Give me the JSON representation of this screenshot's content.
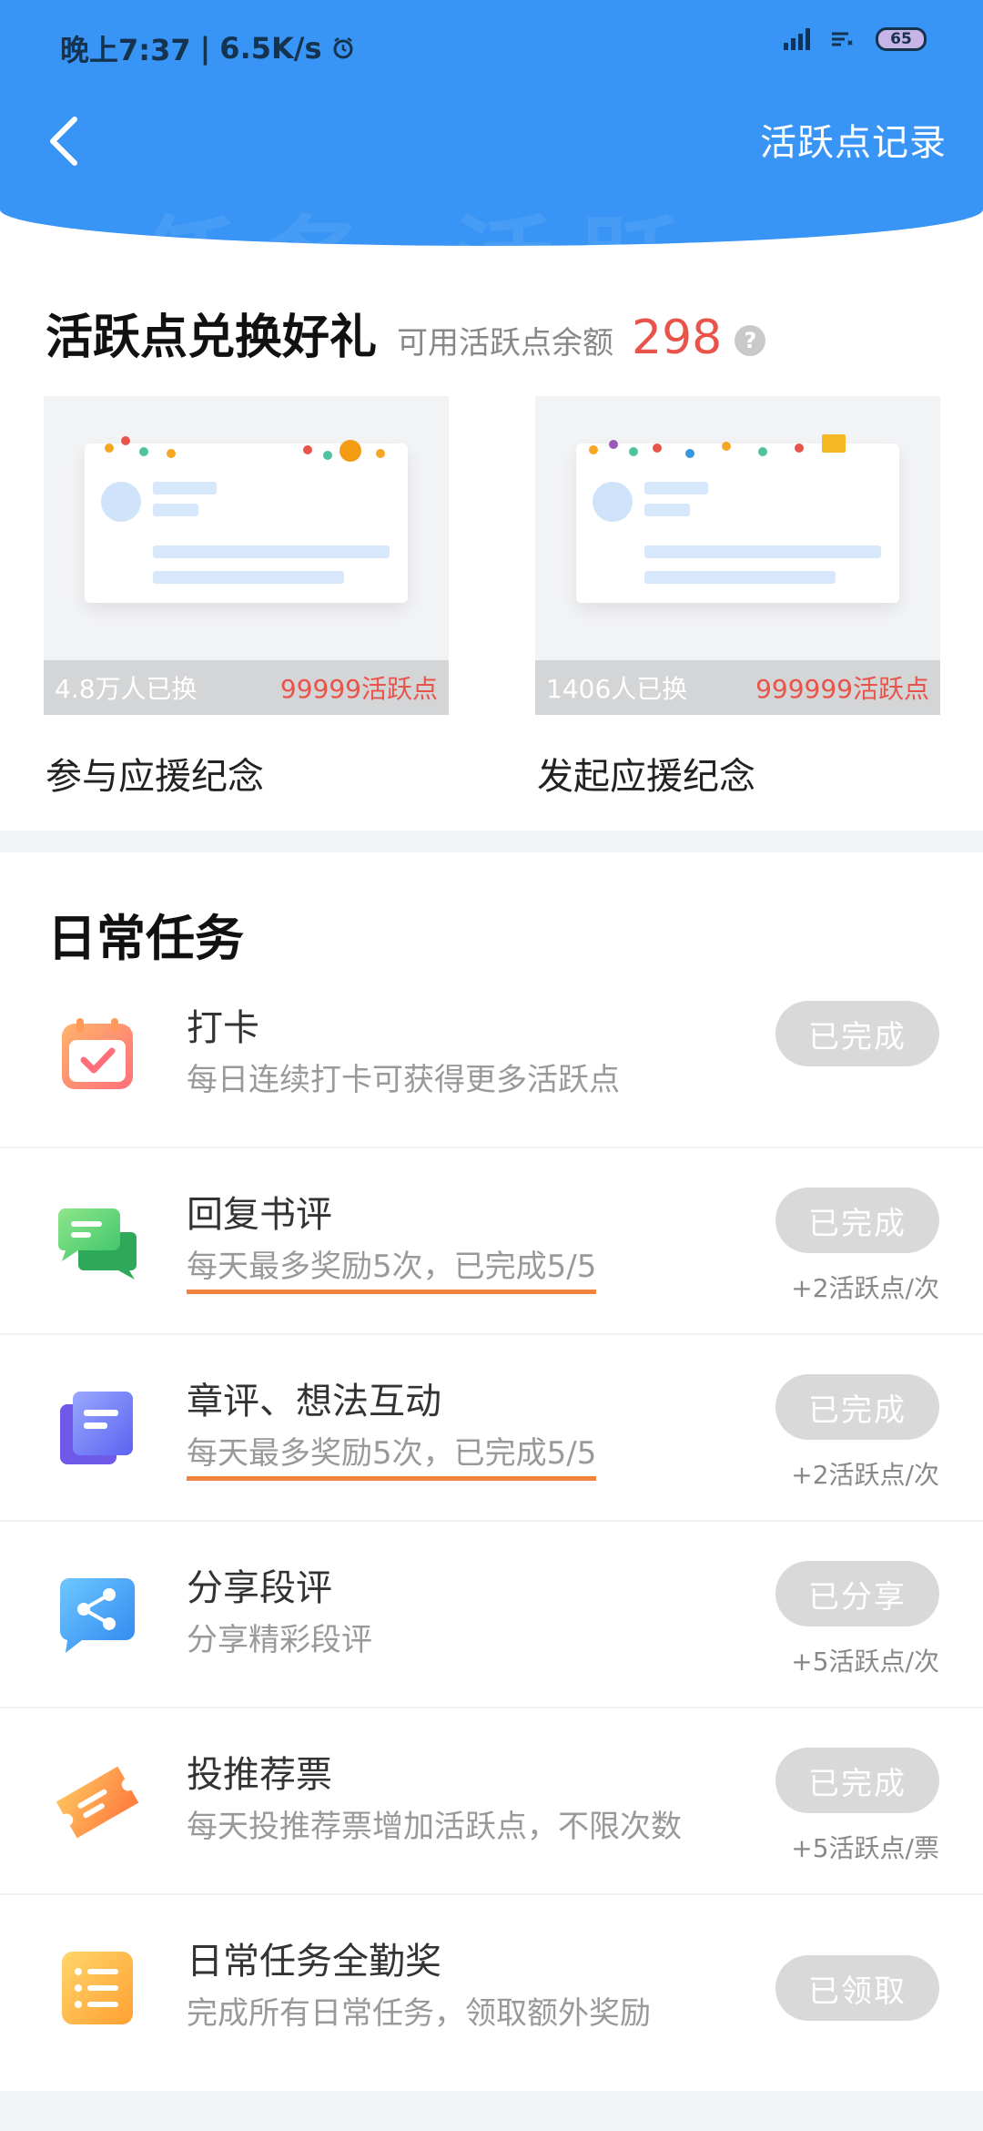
{
  "status_bar": {
    "time": "晚上7:37",
    "speed": "6.5K/s",
    "battery": "65"
  },
  "header": {
    "back_icon": "chevron-left-icon",
    "record_link": "活跃点记录"
  },
  "exchange": {
    "title": "活跃点兑换好礼",
    "balance_label": "可用活跃点余额",
    "balance": "298",
    "help_icon": "question-icon",
    "cards": [
      {
        "count": "4.8万人已换",
        "cost": "99999活跃点",
        "label": "参与应援纪念"
      },
      {
        "count": "1406人已换",
        "cost": "999999活跃点",
        "label": "发起应援纪念"
      }
    ]
  },
  "tasks": {
    "title": "日常任务",
    "items": [
      {
        "icon": "calendar-check-icon",
        "name": "打卡",
        "desc": "每日连续打卡可获得更多活跃点",
        "button": "已完成",
        "reward": ""
      },
      {
        "icon": "chat-bubbles-icon",
        "name": "回复书评",
        "desc": "每天最多奖励5次，已完成5/5",
        "button": "已完成",
        "reward": "+2活跃点/次"
      },
      {
        "icon": "document-icon",
        "name": "章评、想法互动",
        "desc": "每天最多奖励5次，已完成5/5",
        "button": "已完成",
        "reward": "+2活跃点/次"
      },
      {
        "icon": "share-icon",
        "name": "分享段评",
        "desc": "分享精彩段评",
        "button": "已分享",
        "reward": "+5活跃点/次"
      },
      {
        "icon": "ticket-icon",
        "name": "投推荐票",
        "desc": "每天投推荐票增加活跃点，不限次数",
        "button": "已完成",
        "reward": "+5活跃点/票"
      },
      {
        "icon": "list-icon",
        "name": "日常任务全勤奖",
        "desc": "完成所有日常任务，领取额外奖励",
        "button": "已领取",
        "reward": ""
      }
    ]
  },
  "colors": {
    "header_blue": "#3894f5",
    "accent_red": "#e8544a",
    "progress_orange": "#f2833e",
    "button_gray": "#d9d9d9"
  }
}
